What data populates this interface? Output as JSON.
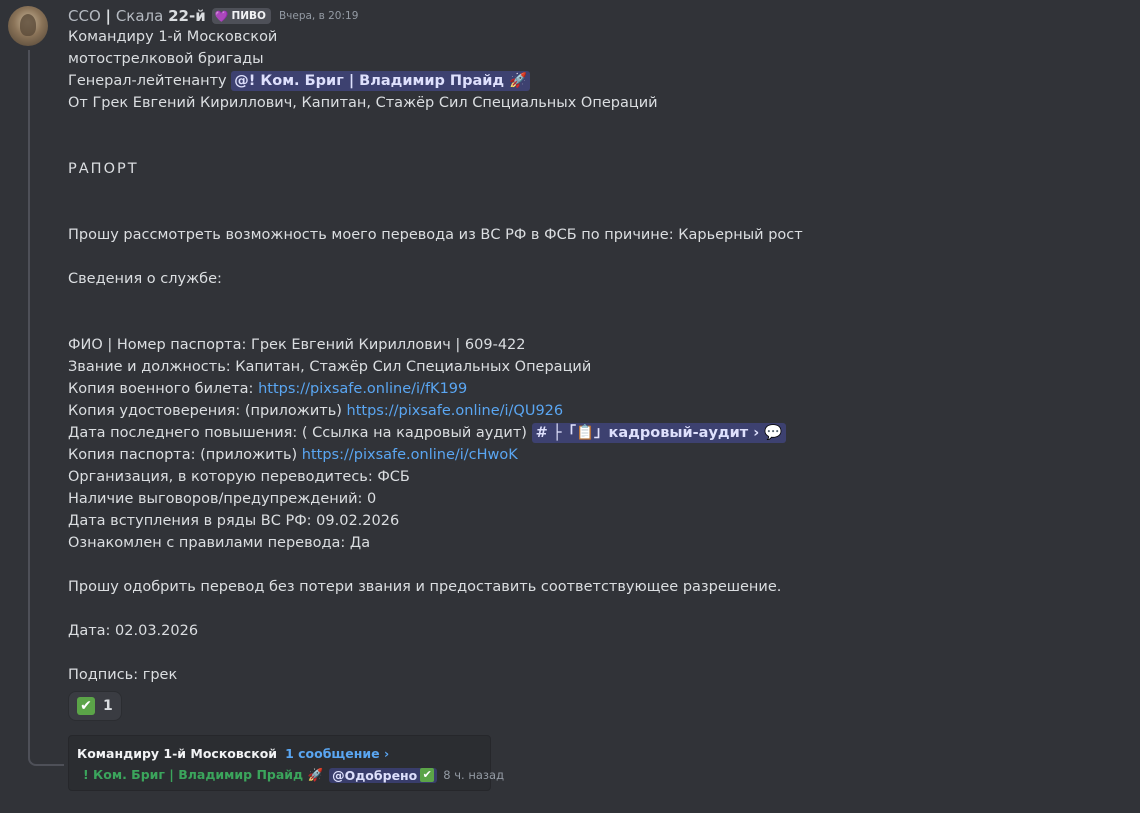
{
  "message": {
    "author_prefix": "ССО",
    "author_sep": "|",
    "author_rest": "Скала",
    "author_num": "22-й",
    "role_tag": "ПИВО",
    "timestamp": "Вчера, в 20:19",
    "lines": {
      "l1": "Командиру 1-й Московской",
      "l2": "мотострелковой бригады",
      "l3_prefix": "Генерал-лейтенанту",
      "l3_mention": "@! Ком. Бриг | Владимир Прайд 🚀",
      "l4": "От Грек Евгений Кириллович, Капитан, Стажёр Сил Специальных Операций",
      "report_title": "РАПОРТ",
      "request": "Прошу рассмотреть возможность моего перевода из ВС РФ в ФСБ по причине: Карьерный рост",
      "service_heading": "Сведения о службе:",
      "fio": "ФИО | Номер паспорта: Грек Евгений Кириллович | 609-422",
      "rank": "Звание и должность: Капитан, Стажёр Сил Специальных Операций",
      "military_id_label": "Копия военного билета:",
      "military_id_link": "https://pixsafe.online/i/fK199",
      "cert_label": "Копия удостоверения: (приложить)",
      "cert_link": "https://pixsafe.online/i/QU926",
      "promotion_label": "Дата последнего повышения: ( Ссылка на кадровый аудит)",
      "promotion_channel": "# ├「📋」кадровый-аудит › 💬",
      "passport_label": "Копия паспорта: (приложить)",
      "passport_link": "https://pixsafe.online/i/cHwoK",
      "org": "Организация, в которую переводитесь: ФСБ",
      "reprimands": "Наличие выговоров/предупреждений: 0",
      "enlist_date": "Дата вступления в ряды ВС РФ:  09.02.2026",
      "rules": "Ознакомлен с правилами перевода:  Да",
      "closing": "Прошу одобрить перевод без потери звания и предоставить соответствующее разрешение.",
      "date": "Дата:  02.03.2026",
      "signature": "Подпись: грек"
    }
  },
  "reaction": {
    "emoji": "✔",
    "count": "1"
  },
  "thread": {
    "name": "Командиру 1-й Московской",
    "message_count": "1 сообщение ›",
    "last_author": "! Ком. Бриг | Владимир Прайд 🚀",
    "last_role_mention": "@Одобрено",
    "last_check": "✔",
    "ago": "8 ч. назад"
  },
  "colors": {
    "background": "#313338",
    "text": "#dbdee1",
    "link": "#5aa6f2",
    "mention_bg": "rgba(88,101,242,0.3)",
    "thread_author": "#3ba55c",
    "check_green": "#5ba448"
  },
  "icons": {
    "avatar": "user-avatar",
    "role_icon": "heart-icon",
    "reaction": "check-mark-icon"
  }
}
